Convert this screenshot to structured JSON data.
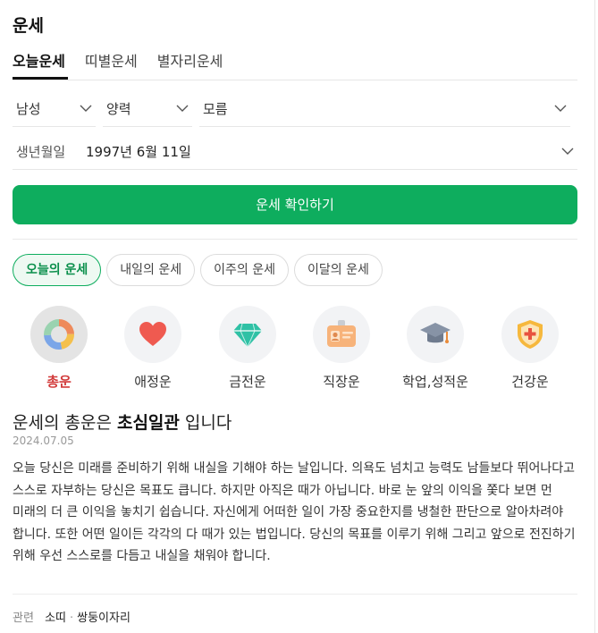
{
  "title": "운세",
  "tabs": [
    {
      "label": "오늘운세",
      "active": true
    },
    {
      "label": "띠별운세",
      "active": false
    },
    {
      "label": "별자리운세",
      "active": false
    }
  ],
  "selects": {
    "gender": "남성",
    "calendar": "양력",
    "birth_time": "모름"
  },
  "birth": {
    "label": "생년월일",
    "value": "1997년 6월 11일"
  },
  "cta_label": "운세 확인하기",
  "periods": [
    {
      "label": "오늘의 운세",
      "active": true
    },
    {
      "label": "내일의 운세",
      "active": false
    },
    {
      "label": "이주의 운세",
      "active": false
    },
    {
      "label": "이달의 운세",
      "active": false
    }
  ],
  "categories": [
    {
      "label": "총운",
      "icon": "pie-chart-icon",
      "active": true
    },
    {
      "label": "애정운",
      "icon": "heart-icon",
      "active": false
    },
    {
      "label": "금전운",
      "icon": "diamond-icon",
      "active": false
    },
    {
      "label": "직장운",
      "icon": "id-badge-icon",
      "active": false
    },
    {
      "label": "학업,성적운",
      "icon": "graduation-cap-icon",
      "active": false
    },
    {
      "label": "건강운",
      "icon": "health-shield-icon",
      "active": false
    }
  ],
  "result": {
    "prefix": "운세의 총운은 ",
    "keyword": "초심일관",
    "suffix": " 입니다",
    "date": "2024.07.05",
    "text": "오늘 당신은 미래를 준비하기 위해 내실을 기해야 하는 날입니다. 의욕도 넘치고 능력도 남들보다 뛰어나다고 스스로 자부하는 당신은 목표도 큽니다. 하지만 아직은 때가 아닙니다. 바로 눈 앞의 이익을 쫓다 보면 먼 미래의 더 큰 이익을 놓치기 쉽습니다. 자신에게 어떠한 일이 가장 중요한지를 냉철한 판단으로 알아차려야 합니다. 또한 어떤 일이든 각각의 다 때가 있는 법입니다. 당신의 목표를 이루기 위해 그리고 앞으로 전진하기 위해 우선 스스로를 다듬고 내실을 채워야 합니다."
  },
  "related": {
    "label": "관련",
    "links": [
      "소띠",
      "쌍둥이자리"
    ],
    "separator": "·"
  },
  "colors": {
    "accent_green": "#0ead5e",
    "active_category_red": "#d23b3b"
  }
}
